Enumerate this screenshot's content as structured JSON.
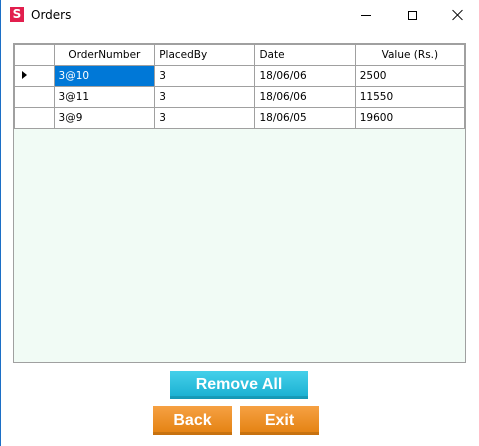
{
  "window": {
    "title": "Orders",
    "app_icon_letter": "S"
  },
  "colors": {
    "selection": "#0078d7",
    "grid_background": "#f1fbf5",
    "remove_button": "#2bbbd6",
    "action_buttons": "#ee8f27"
  },
  "grid": {
    "columns": [
      "OrderNumber",
      "PlacedBy",
      "Date",
      "Value (Rs.)"
    ],
    "rows": [
      [
        "3@10",
        "3",
        "18/06/06",
        "2500"
      ],
      [
        "3@11",
        "3",
        "18/06/06",
        "11550"
      ],
      [
        "3@9",
        "3",
        "18/06/05",
        "19600"
      ]
    ],
    "current_row_indicator": "row-0"
  },
  "buttons": {
    "remove_all": "Remove All",
    "back": "Back",
    "exit": "Exit"
  }
}
